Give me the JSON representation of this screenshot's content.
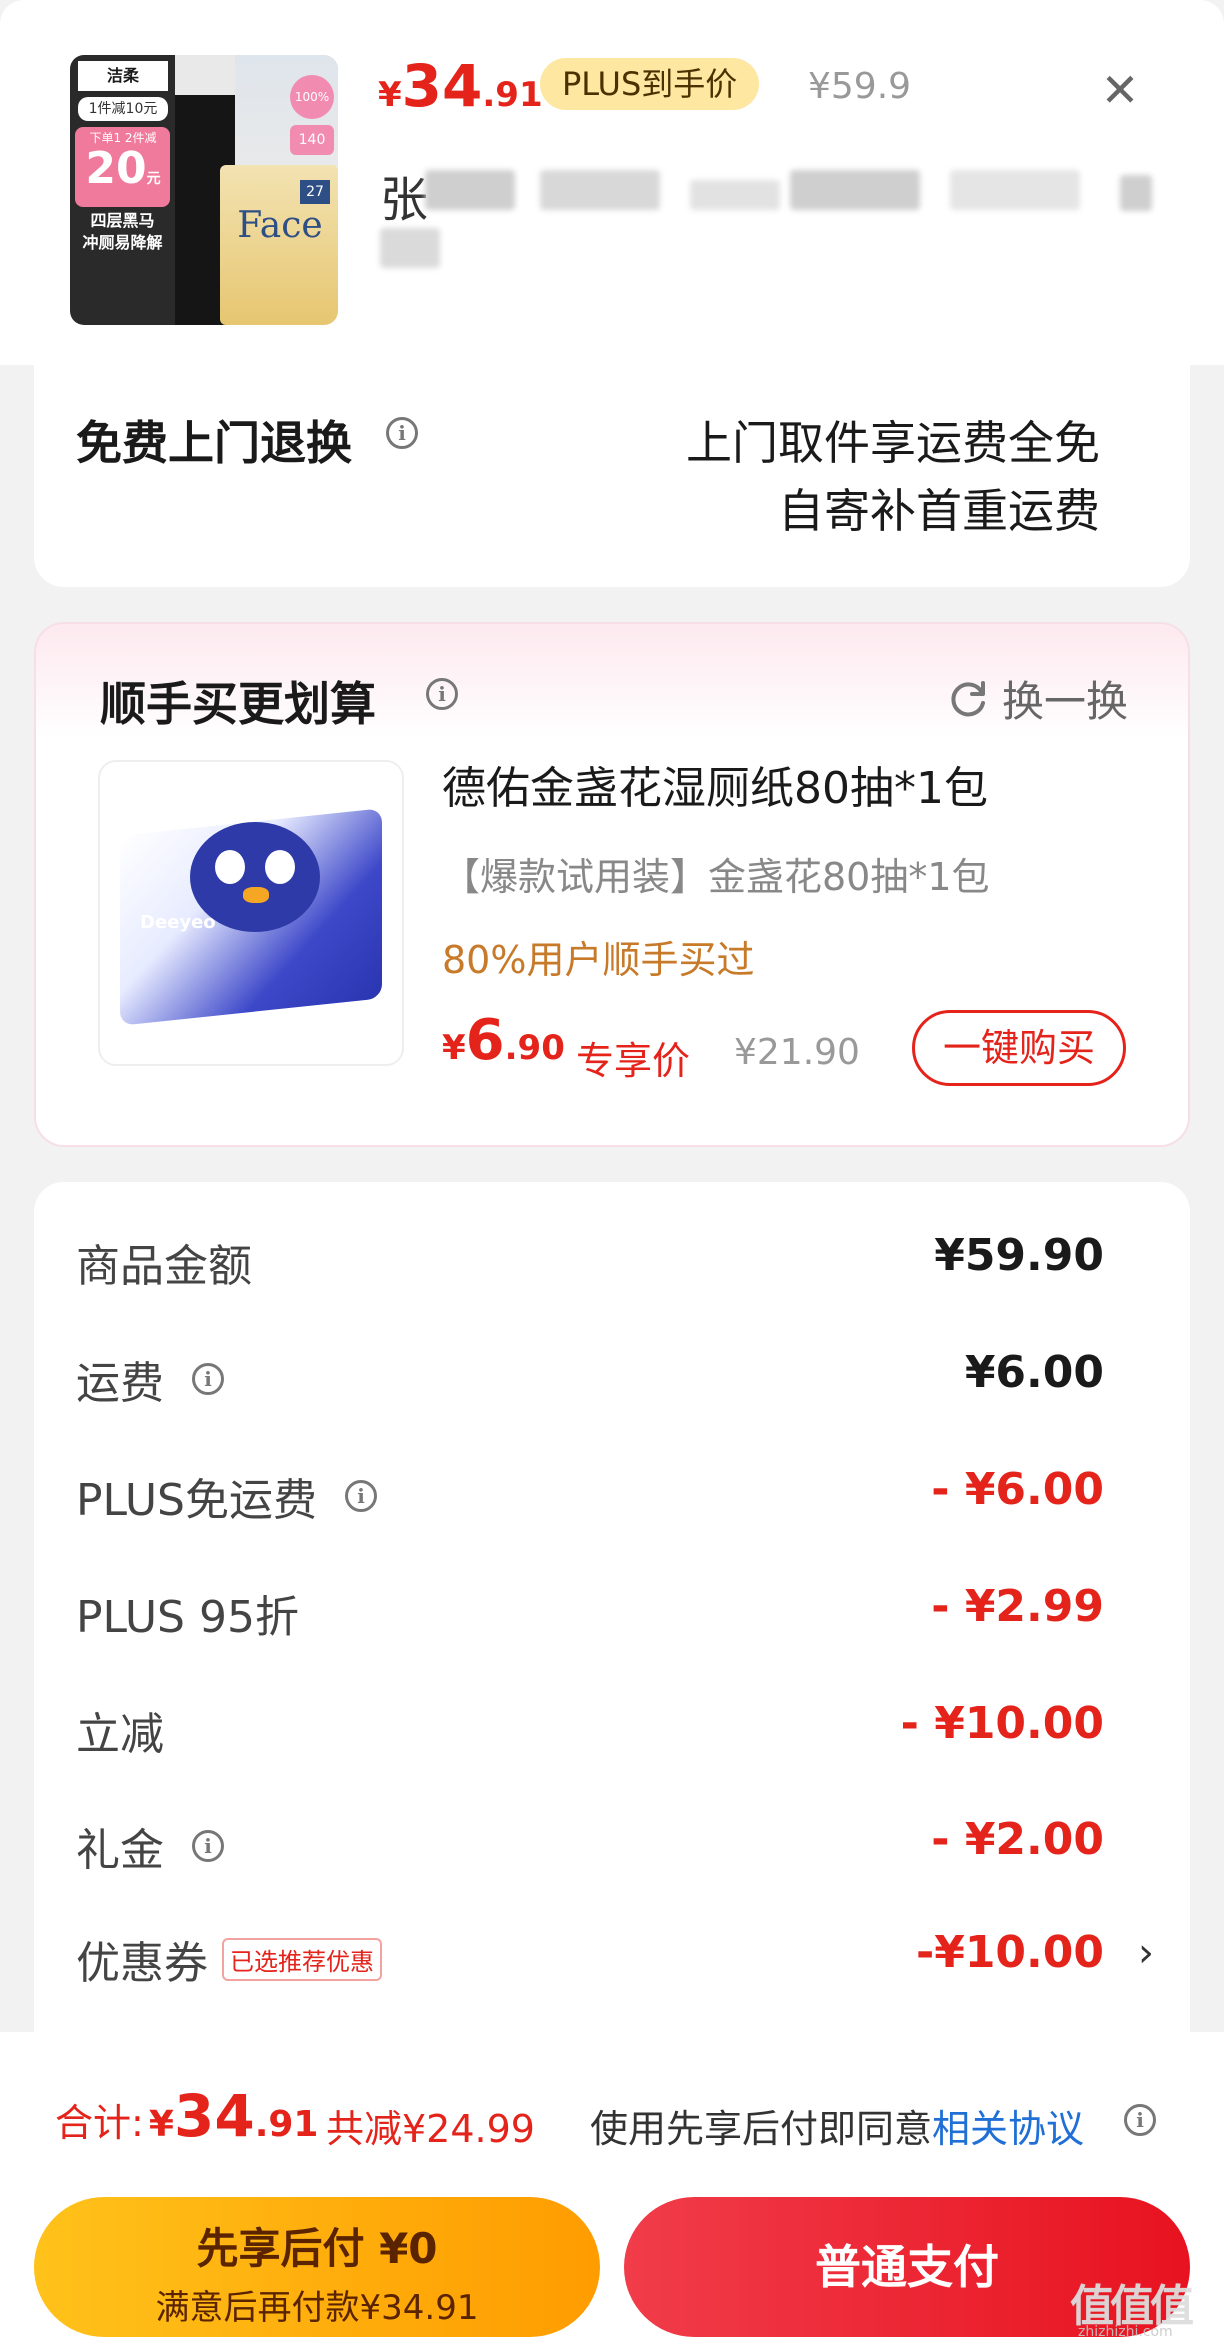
{
  "product": {
    "price_currency": "¥",
    "price_int": "34",
    "price_dec": ".91",
    "plus_badge": "PLUS到手价",
    "original_price": "¥59.9",
    "title_obscured": "张",
    "thumb_brand": "洁柔",
    "thumb_promo_top": "1件减10元",
    "thumb_promo_mid": "下单1 2件减",
    "thumb_big": "20",
    "thumb_unit": "元",
    "thumb_line1": "四层黑马",
    "thumb_line2": "冲厕易降解",
    "thumb_face": "Face",
    "thumb_badge": "100%",
    "thumb_badge2": "140",
    "thumb_pack": "27"
  },
  "returns": {
    "title": "免费上门退换",
    "line1": "上门取件享运费全免",
    "line2": "自寄补首重运费"
  },
  "addon": {
    "title": "顺手买更划算",
    "refresh_label": "换一换",
    "item_title": "德佑金盏花湿厕纸80抽*1包",
    "item_spec": "【爆款试用装】金盏花80抽*1包",
    "item_social": "80%用户顺手买过",
    "price_currency": "¥",
    "price_int": "6",
    "price_dec": ".90",
    "price_tag": "专享价",
    "original_price": "¥21.90",
    "buy_label": "一键购买",
    "pack_brand": "Deeyeo"
  },
  "summary": {
    "rows": [
      {
        "label": "商品金额",
        "value": "¥59.90",
        "red": false,
        "info": false
      },
      {
        "label": "运费",
        "value": "¥6.00",
        "red": false,
        "info": true
      },
      {
        "label": "PLUS免运费",
        "value": "- ¥6.00",
        "red": true,
        "info": true
      },
      {
        "label": "PLUS 95折",
        "value": "- ¥2.99",
        "red": true,
        "info": false
      },
      {
        "label": "立减",
        "value": "- ¥10.00",
        "red": true,
        "info": false
      },
      {
        "label": "礼金",
        "value": "- ¥2.00",
        "red": true,
        "info": true
      }
    ],
    "coupon_label": "优惠券",
    "coupon_tag": "已选推荐优惠",
    "coupon_value": "-¥10.00"
  },
  "footer": {
    "total_label": "合计:",
    "total_currency": "¥",
    "total_int": "34",
    "total_dec": ".91",
    "saved": "共减¥24.99",
    "agree_text": "使用先享后付即同意",
    "agree_link": "相关协议",
    "paylater_title": "先享后付 ¥0",
    "paylater_sub": "满意后再付款¥34.91",
    "pay_label": "普通支付",
    "watermark": "值值值",
    "watermark_url": "zhizhizhi.com"
  },
  "colors": {
    "accent_red": "#e4231b",
    "gold_badge": "#fde7a1",
    "orange_text": "#c77a2a",
    "paylater_gradient": [
      "#ffc21a",
      "#ff9c00"
    ],
    "pay_gradient": [
      "#f13c4a",
      "#e8121f"
    ]
  },
  "icons": [
    "close-icon",
    "info-icon",
    "refresh-icon",
    "chevron-right-icon"
  ]
}
